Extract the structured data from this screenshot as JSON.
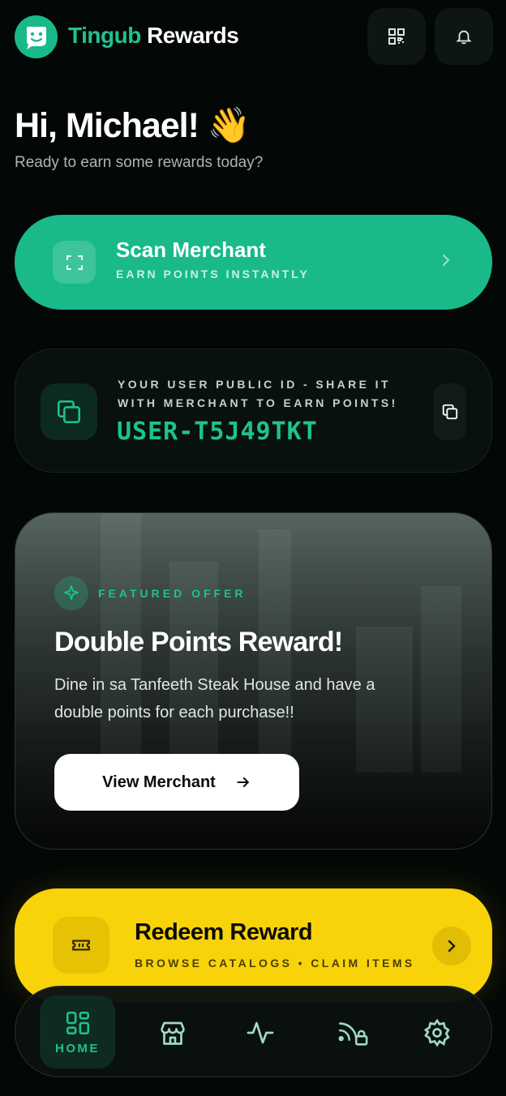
{
  "header": {
    "brand_accent": "Tingub",
    "brand_rest": " Rewards",
    "icons": [
      "smile-logo-icon",
      "qr-code-icon",
      "bell-icon"
    ]
  },
  "greeting": {
    "title": "Hi, Michael! 👋",
    "subtitle": "Ready to earn some rewards today?"
  },
  "scan": {
    "title": "Scan Merchant",
    "subtitle": "EARN POINTS INSTANTLY"
  },
  "user_id": {
    "label": "YOUR USER PUBLIC ID - SHARE IT WITH MERCHANT TO EARN POINTS!",
    "value": "USER-T5J49TKT"
  },
  "featured": {
    "tag": "FEATURED OFFER",
    "title": "Double Points Reward!",
    "description": "Dine in sa Tanfeeth Steak House and have a double points for each purchase!!",
    "button": "View Merchant"
  },
  "redeem": {
    "title": "Redeem Reward",
    "subtitle": "BROWSE CATALOGS • CLAIM ITEMS"
  },
  "nav": {
    "home_label": "HOME",
    "items": [
      "home-icon",
      "store-icon",
      "activity-icon",
      "rss-lock-icon",
      "settings-icon"
    ]
  },
  "colors": {
    "accent": "#19b98a",
    "accent_text": "#1ec28f",
    "yellow": "#f8d30a",
    "background": "#030706"
  }
}
